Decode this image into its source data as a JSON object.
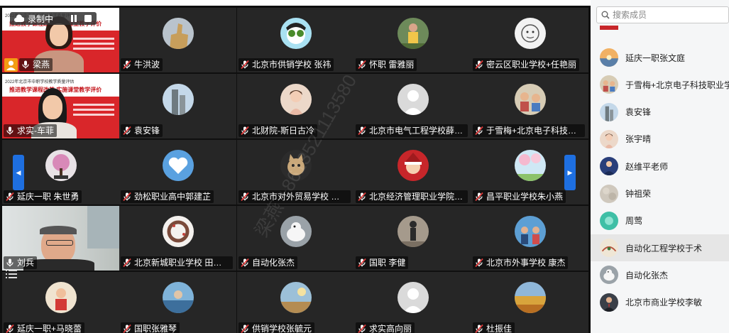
{
  "recording": {
    "label": "录制中"
  },
  "watermark": {
    "text": "梁燕 +8613521113580"
  },
  "grid": {
    "tiles": [
      {
        "name": "梁燕",
        "kind": "slide",
        "mic": "on",
        "highlight": true
      },
      {
        "name": "牛洪波",
        "kind": "avatar",
        "avatar": "thumb",
        "mic": "muted"
      },
      {
        "name": "北京市供销学校 张祎",
        "kind": "avatar",
        "avatar": "cartoon",
        "mic": "muted"
      },
      {
        "name": "怀职 雷雅丽",
        "kind": "avatar",
        "avatar": "person-park",
        "mic": "muted"
      },
      {
        "name": "密云区职业学校+任艳丽",
        "kind": "avatar",
        "avatar": "sketch",
        "mic": "muted"
      },
      {
        "name": "求实-车菲",
        "kind": "slide-cam",
        "mic": "on"
      },
      {
        "name": "袁安锋",
        "kind": "avatar",
        "avatar": "tower",
        "mic": "muted"
      },
      {
        "name": "北财院-斯日古冷",
        "kind": "avatar",
        "avatar": "girl",
        "mic": "muted"
      },
      {
        "name": "北京市电气工程学校薛翠花",
        "kind": "avatar",
        "avatar": "default",
        "mic": "muted"
      },
      {
        "name": "于雪梅+北京电子科技职...",
        "kind": "avatar",
        "avatar": "kids",
        "mic": "muted"
      },
      {
        "name": "延庆一职 朱世勇",
        "kind": "avatar",
        "avatar": "bonsai",
        "mic": "muted"
      },
      {
        "name": "劲松职业高中郭建芷",
        "kind": "avatar",
        "avatar": "sky-heart",
        "mic": "muted"
      },
      {
        "name": "北京市对外贸易学校 路颖",
        "kind": "avatar",
        "avatar": "cat",
        "mic": "muted"
      },
      {
        "name": "北京经济管理职业学院 胡...",
        "kind": "avatar",
        "avatar": "santa",
        "mic": "muted"
      },
      {
        "name": "昌平职业学校朱小燕",
        "kind": "avatar",
        "avatar": "blossom",
        "mic": "muted"
      },
      {
        "name": "刘兵",
        "kind": "camera",
        "mic": "on",
        "active": true
      },
      {
        "name": "北京新城职业学校 田贺男",
        "kind": "avatar",
        "avatar": "wreath",
        "mic": "muted"
      },
      {
        "name": "自动化张杰",
        "kind": "avatar",
        "avatar": "bird",
        "mic": "muted"
      },
      {
        "name": "国职 李健",
        "kind": "avatar",
        "avatar": "silhouette",
        "mic": "muted"
      },
      {
        "name": "北京市外事学校 康杰",
        "kind": "avatar",
        "avatar": "group-blue",
        "mic": "muted"
      },
      {
        "name": "延庆一职+马晓蕾",
        "kind": "avatar",
        "avatar": "child-red",
        "mic": "muted"
      },
      {
        "name": "国职张雅琴",
        "kind": "avatar",
        "avatar": "sea",
        "mic": "muted"
      },
      {
        "name": "供销学校张毓元",
        "kind": "avatar",
        "avatar": "nature",
        "mic": "muted"
      },
      {
        "name": "求实高向丽",
        "kind": "avatar",
        "avatar": "default",
        "mic": "muted"
      },
      {
        "name": "杜振佳",
        "kind": "avatar",
        "avatar": "autumn",
        "mic": "muted"
      }
    ]
  },
  "slide": {
    "header": "2022年北京市中职学校教学质量评估",
    "title": "推进教学课程改革 实施课堂教学评价"
  },
  "sidebar": {
    "search_placeholder": "搜索成员",
    "members": [
      {
        "name": "延庆一职张文庭",
        "avatar": "sunset"
      },
      {
        "name": "于雪梅+北京电子科技职业学院",
        "avatar": "kids"
      },
      {
        "name": "袁安锋",
        "avatar": "tower"
      },
      {
        "name": "张宇晴",
        "avatar": "girl"
      },
      {
        "name": "赵维平老师",
        "avatar": "woman"
      },
      {
        "name": "钟祖荣",
        "avatar": "texture"
      },
      {
        "name": "周莺",
        "avatar": "teal"
      },
      {
        "name": "自动化工程学校于术",
        "avatar": "sketch2",
        "selected": true
      },
      {
        "name": "自动化张杰",
        "avatar": "bird"
      },
      {
        "name": "北京市商业学校李敏",
        "avatar": "man"
      }
    ]
  },
  "colors": {
    "accent": "#1e6fe0",
    "active_border": "#3cc36b",
    "grid_bg": "#0f0f0f",
    "tile_bg": "#262626",
    "muted_icon": "#e03c3c"
  }
}
